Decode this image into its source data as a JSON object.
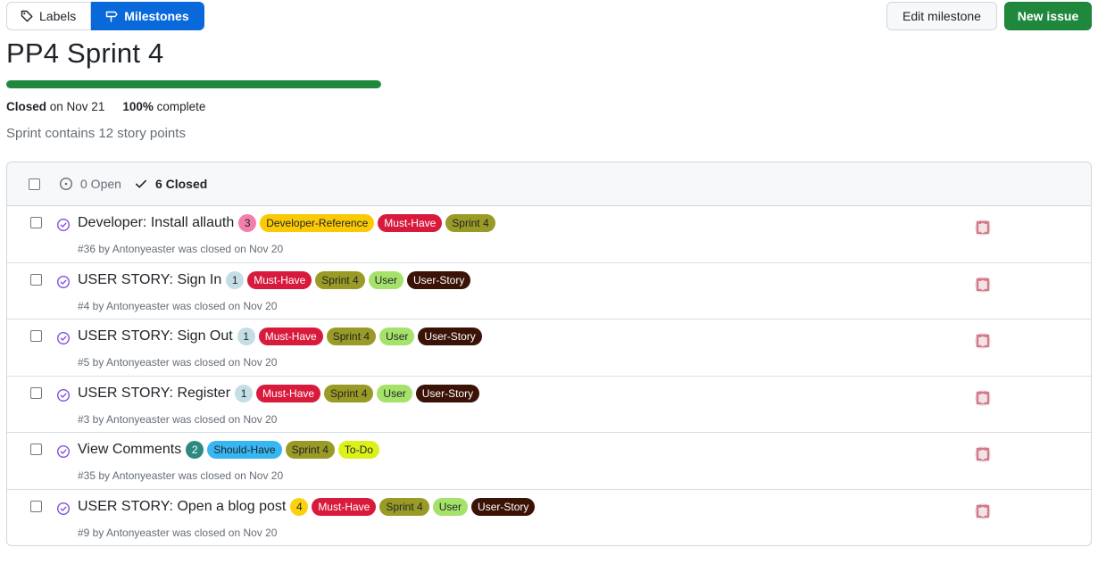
{
  "nav": {
    "labels_tab": "Labels",
    "milestones_tab": "Milestones",
    "edit_button": "Edit milestone",
    "new_button": "New issue"
  },
  "milestone": {
    "title": "PP4 Sprint 4",
    "progress": 1.0,
    "closed_prefix": "Closed",
    "closed_suffix": "on Nov 21",
    "percent": "100%",
    "percent_suffix": "complete",
    "description": "Sprint contains 12 story points"
  },
  "list_header": {
    "open_count": "0 Open",
    "closed_count": "6 Closed"
  },
  "colors": {
    "progress": "#1f883d",
    "closed_issue_icon": "#8250df",
    "new_button": "#1f883d",
    "selected_tab": "#0969da"
  },
  "issues": [
    {
      "title": "Developer: Install allauth",
      "count": "3",
      "count_bg": "#f27fa9",
      "count_fg": "#1f2328",
      "labels": [
        {
          "text": "Developer-Reference",
          "bg": "#fbca04",
          "fg": "#1f2328"
        },
        {
          "text": "Must-Have",
          "bg": "#d81b3c",
          "fg": "#ffffff"
        },
        {
          "text": "Sprint 4",
          "bg": "#9a9a26",
          "fg": "#1f2328"
        }
      ],
      "meta": "#36 by Antonyeaster was closed on Nov 20"
    },
    {
      "title": "USER STORY: Sign In",
      "count": "1",
      "count_bg": "#c5dee5",
      "count_fg": "#1f2328",
      "labels": [
        {
          "text": "Must-Have",
          "bg": "#d81b3c",
          "fg": "#ffffff"
        },
        {
          "text": "Sprint 4",
          "bg": "#9a9a26",
          "fg": "#1f2328"
        },
        {
          "text": "User",
          "bg": "#a5e26a",
          "fg": "#1f2328"
        },
        {
          "text": "User-Story",
          "bg": "#3a1206",
          "fg": "#ffffff"
        }
      ],
      "meta": "#4 by Antonyeaster was closed on Nov 20"
    },
    {
      "title": "USER STORY: Sign Out",
      "count": "1",
      "count_bg": "#c5dee5",
      "count_fg": "#1f2328",
      "labels": [
        {
          "text": "Must-Have",
          "bg": "#d81b3c",
          "fg": "#ffffff"
        },
        {
          "text": "Sprint 4",
          "bg": "#9a9a26",
          "fg": "#1f2328"
        },
        {
          "text": "User",
          "bg": "#a5e26a",
          "fg": "#1f2328"
        },
        {
          "text": "User-Story",
          "bg": "#3a1206",
          "fg": "#ffffff"
        }
      ],
      "meta": "#5 by Antonyeaster was closed on Nov 20"
    },
    {
      "title": "USER STORY: Register",
      "count": "1",
      "count_bg": "#c5dee5",
      "count_fg": "#1f2328",
      "labels": [
        {
          "text": "Must-Have",
          "bg": "#d81b3c",
          "fg": "#ffffff"
        },
        {
          "text": "Sprint 4",
          "bg": "#9a9a26",
          "fg": "#1f2328"
        },
        {
          "text": "User",
          "bg": "#a5e26a",
          "fg": "#1f2328"
        },
        {
          "text": "User-Story",
          "bg": "#3a1206",
          "fg": "#ffffff"
        }
      ],
      "meta": "#3 by Antonyeaster was closed on Nov 20"
    },
    {
      "title": "View Comments",
      "count": "2",
      "count_bg": "#2e8a7e",
      "count_fg": "#ffffff",
      "labels": [
        {
          "text": "Should-Have",
          "bg": "#38b6f2",
          "fg": "#1f2328"
        },
        {
          "text": "Sprint 4",
          "bg": "#9a9a26",
          "fg": "#1f2328"
        },
        {
          "text": "To-Do",
          "bg": "#dcf01a",
          "fg": "#1f2328"
        }
      ],
      "meta": "#35 by Antonyeaster was closed on Nov 20"
    },
    {
      "title": "USER STORY: Open a blog post",
      "count": "4",
      "count_bg": "#fbd10c",
      "count_fg": "#1f2328",
      "labels": [
        {
          "text": "Must-Have",
          "bg": "#d81b3c",
          "fg": "#ffffff"
        },
        {
          "text": "Sprint 4",
          "bg": "#9a9a26",
          "fg": "#1f2328"
        },
        {
          "text": "User",
          "bg": "#a5e26a",
          "fg": "#1f2328"
        },
        {
          "text": "User-Story",
          "bg": "#3a1206",
          "fg": "#ffffff"
        }
      ],
      "meta": "#9 by Antonyeaster was closed on Nov 20"
    }
  ]
}
